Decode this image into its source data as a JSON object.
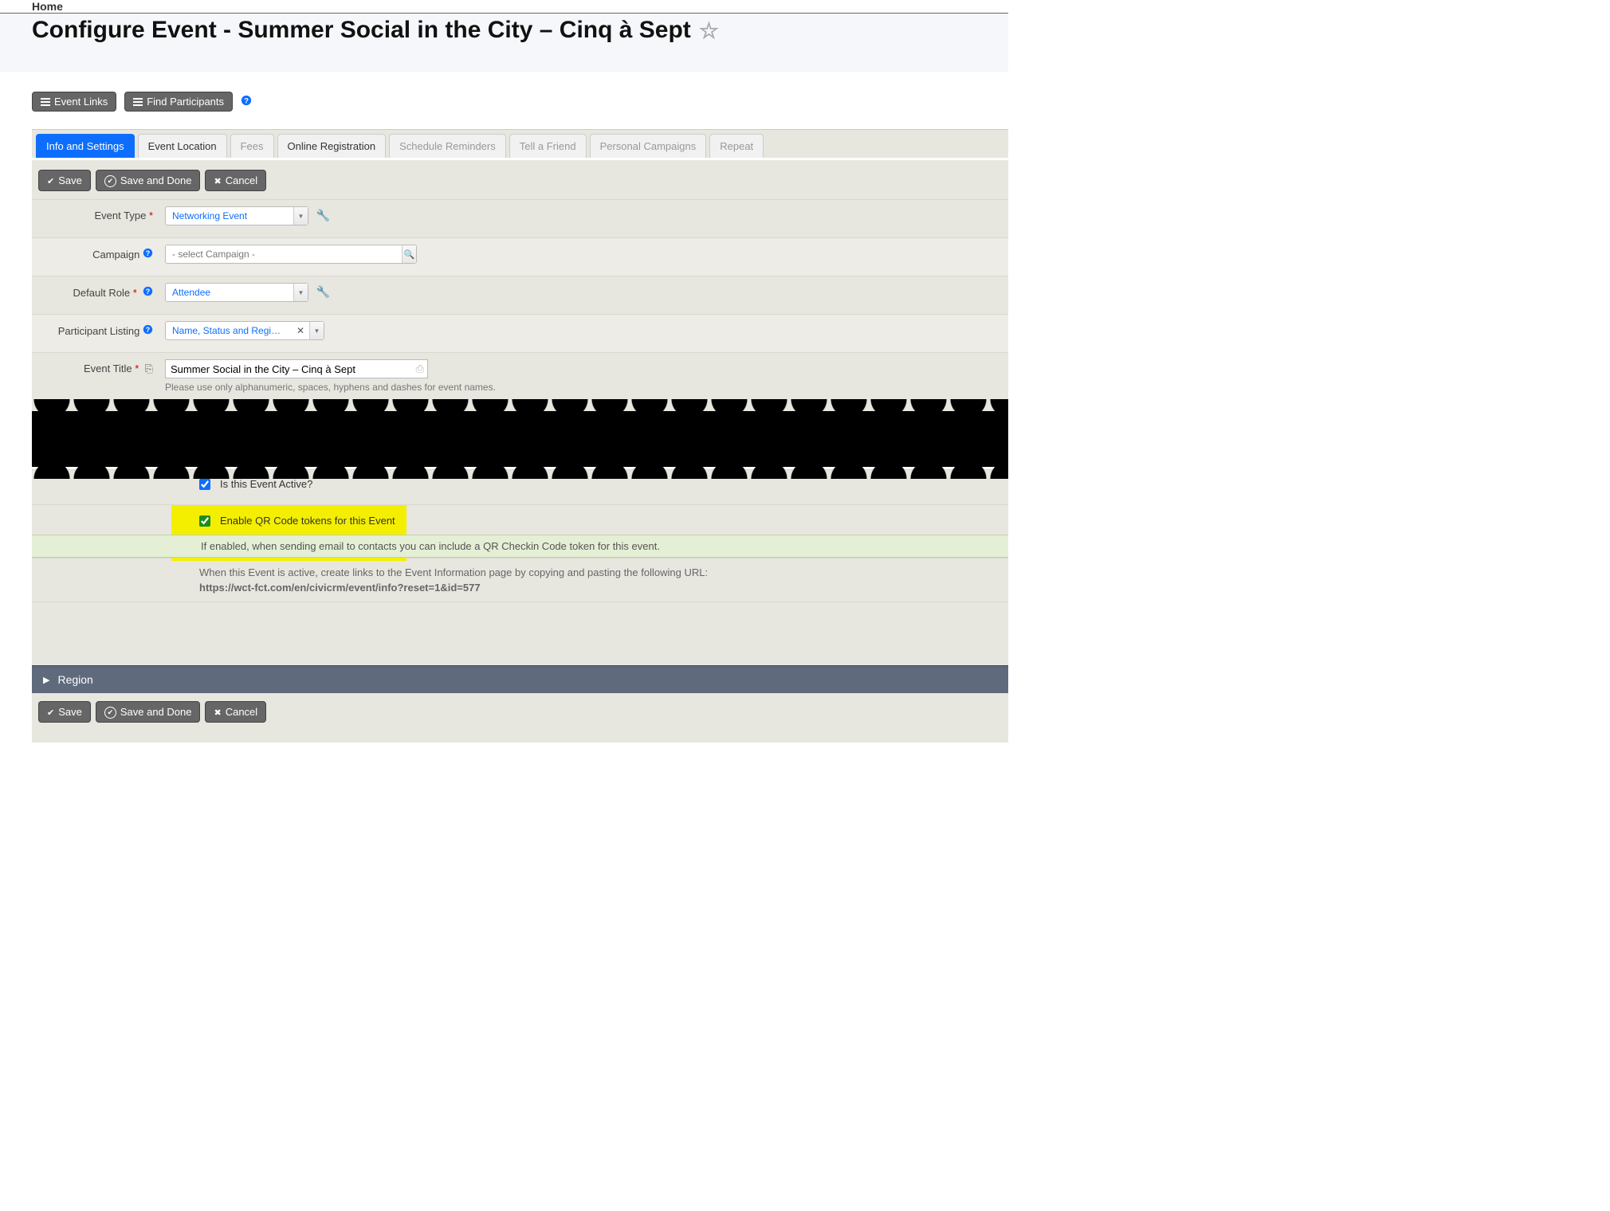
{
  "breadcrumb": {
    "home": "Home"
  },
  "header": {
    "title": "Configure Event - Summer Social in the City – Cinq à Sept"
  },
  "topButtons": {
    "eventLinks": "Event Links",
    "findParticipants": "Find Participants"
  },
  "tabs": {
    "infoSettings": "Info and Settings",
    "eventLocation": "Event Location",
    "fees": "Fees",
    "onlineRegistration": "Online Registration",
    "scheduleReminders": "Schedule Reminders",
    "tellAFriend": "Tell a Friend",
    "personalCampaigns": "Personal Campaigns",
    "repeat": "Repeat"
  },
  "actions": {
    "save": "Save",
    "saveDone": "Save and Done",
    "cancel": "Cancel"
  },
  "form": {
    "eventType": {
      "label": "Event Type",
      "value": "Networking Event"
    },
    "campaign": {
      "label": "Campaign",
      "placeholder": "- select Campaign -"
    },
    "defaultRole": {
      "label": "Default Role",
      "value": "Attendee"
    },
    "participantListing": {
      "label": "Participant Listing",
      "value": "Name, Status and Regis…"
    },
    "eventTitle": {
      "label": "Event Title",
      "value": "Summer Social in the City – Cinq à Sept",
      "help": "Please use only alphanumeric, spaces, hyphens and dashes for event names."
    },
    "isActive": {
      "label": "Is this Event Active?"
    },
    "qrCode": {
      "label": "Enable QR Code tokens for this Event",
      "help": "If enabled, when sending email to contacts you can include a QR Checkin Code token for this event."
    },
    "info": {
      "text": "When this Event is active, create links to the Event Information page by copying and pasting the following URL:",
      "url": "https://wct-fct.com/en/civicrm/event/info?reset=1&id=577"
    },
    "region": "Region"
  }
}
